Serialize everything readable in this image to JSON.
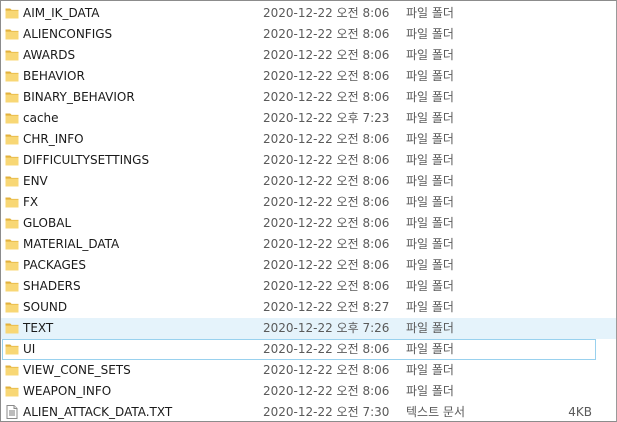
{
  "rows": [
    {
      "name": "AIM_IK_DATA",
      "date": "2020-12-22 오전 8:06",
      "type": "파일 폴더",
      "size": "",
      "icon": "folder-icon"
    },
    {
      "name": "ALIENCONFIGS",
      "date": "2020-12-22 오전 8:06",
      "type": "파일 폴더",
      "size": "",
      "icon": "folder-icon"
    },
    {
      "name": "AWARDS",
      "date": "2020-12-22 오전 8:06",
      "type": "파일 폴더",
      "size": "",
      "icon": "folder-icon"
    },
    {
      "name": "BEHAVIOR",
      "date": "2020-12-22 오전 8:06",
      "type": "파일 폴더",
      "size": "",
      "icon": "folder-icon"
    },
    {
      "name": "BINARY_BEHAVIOR",
      "date": "2020-12-22 오전 8:06",
      "type": "파일 폴더",
      "size": "",
      "icon": "folder-icon"
    },
    {
      "name": "cache",
      "date": "2020-12-22 오후 7:23",
      "type": "파일 폴더",
      "size": "",
      "icon": "folder-icon"
    },
    {
      "name": "CHR_INFO",
      "date": "2020-12-22 오전 8:06",
      "type": "파일 폴더",
      "size": "",
      "icon": "folder-icon"
    },
    {
      "name": "DIFFICULTYSETTINGS",
      "date": "2020-12-22 오전 8:06",
      "type": "파일 폴더",
      "size": "",
      "icon": "folder-icon"
    },
    {
      "name": "ENV",
      "date": "2020-12-22 오전 8:06",
      "type": "파일 폴더",
      "size": "",
      "icon": "folder-icon"
    },
    {
      "name": "FX",
      "date": "2020-12-22 오전 8:06",
      "type": "파일 폴더",
      "size": "",
      "icon": "folder-icon"
    },
    {
      "name": "GLOBAL",
      "date": "2020-12-22 오전 8:06",
      "type": "파일 폴더",
      "size": "",
      "icon": "folder-icon"
    },
    {
      "name": "MATERIAL_DATA",
      "date": "2020-12-22 오전 8:06",
      "type": "파일 폴더",
      "size": "",
      "icon": "folder-icon"
    },
    {
      "name": "PACKAGES",
      "date": "2020-12-22 오전 8:06",
      "type": "파일 폴더",
      "size": "",
      "icon": "folder-icon"
    },
    {
      "name": "SHADERS",
      "date": "2020-12-22 오전 8:06",
      "type": "파일 폴더",
      "size": "",
      "icon": "folder-icon"
    },
    {
      "name": "SOUND",
      "date": "2020-12-22 오전 8:27",
      "type": "파일 폴더",
      "size": "",
      "icon": "folder-icon"
    },
    {
      "name": "TEXT",
      "date": "2020-12-22 오후 7:26",
      "type": "파일 폴더",
      "size": "",
      "icon": "folder-icon",
      "state": "hover"
    },
    {
      "name": "UI",
      "date": "2020-12-22 오전 8:06",
      "type": "파일 폴더",
      "size": "",
      "icon": "folder-icon",
      "state": "focus"
    },
    {
      "name": "VIEW_CONE_SETS",
      "date": "2020-12-22 오전 8:06",
      "type": "파일 폴더",
      "size": "",
      "icon": "folder-icon"
    },
    {
      "name": "WEAPON_INFO",
      "date": "2020-12-22 오전 8:06",
      "type": "파일 폴더",
      "size": "",
      "icon": "folder-icon"
    },
    {
      "name": "ALIEN_ATTACK_DATA.TXT",
      "date": "2020-12-22 오전 7:30",
      "type": "텍스트 문서",
      "size": "4KB",
      "icon": "text-file-icon"
    }
  ],
  "colors": {
    "folder": "#f8d775",
    "folder_dark": "#e3b23c",
    "hover_bg": "#e5f3fb",
    "focus_border": "#99d1ee",
    "text": "#1a1a1a",
    "muted_text": "#5a5a5a"
  }
}
